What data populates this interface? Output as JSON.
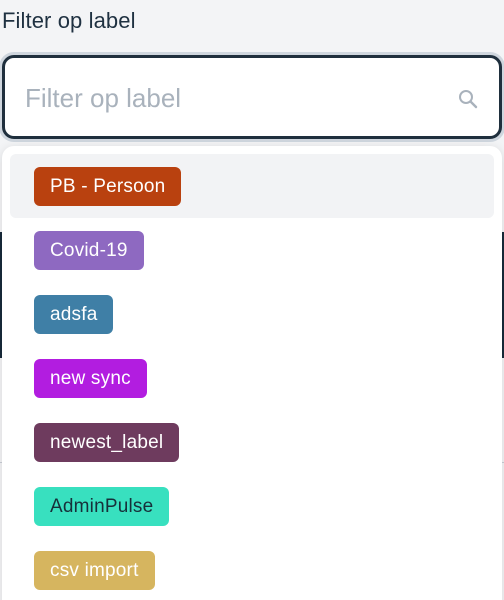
{
  "filter": {
    "label": "Filter op label",
    "placeholder": "Filter op label",
    "value": ""
  },
  "options": [
    {
      "label": "PB - Persoon",
      "color": "#b9410f",
      "text_color": "#ffffff",
      "highlighted": true
    },
    {
      "label": "Covid-19",
      "color": "#8e69c1",
      "text_color": "#ffffff",
      "highlighted": false
    },
    {
      "label": "adsfa",
      "color": "#3f7fa6",
      "text_color": "#ffffff",
      "highlighted": false
    },
    {
      "label": "new sync",
      "color": "#b21de0",
      "text_color": "#ffffff",
      "highlighted": false
    },
    {
      "label": "newest_label",
      "color": "#6e3b5e",
      "text_color": "#ffffff",
      "highlighted": false
    },
    {
      "label": "AdminPulse",
      "color": "#38e0bf",
      "text_color": "#17303a",
      "highlighted": false
    },
    {
      "label": "csv import",
      "color": "#d6b55f",
      "text_color": "#ffffff",
      "highlighted": false
    }
  ]
}
